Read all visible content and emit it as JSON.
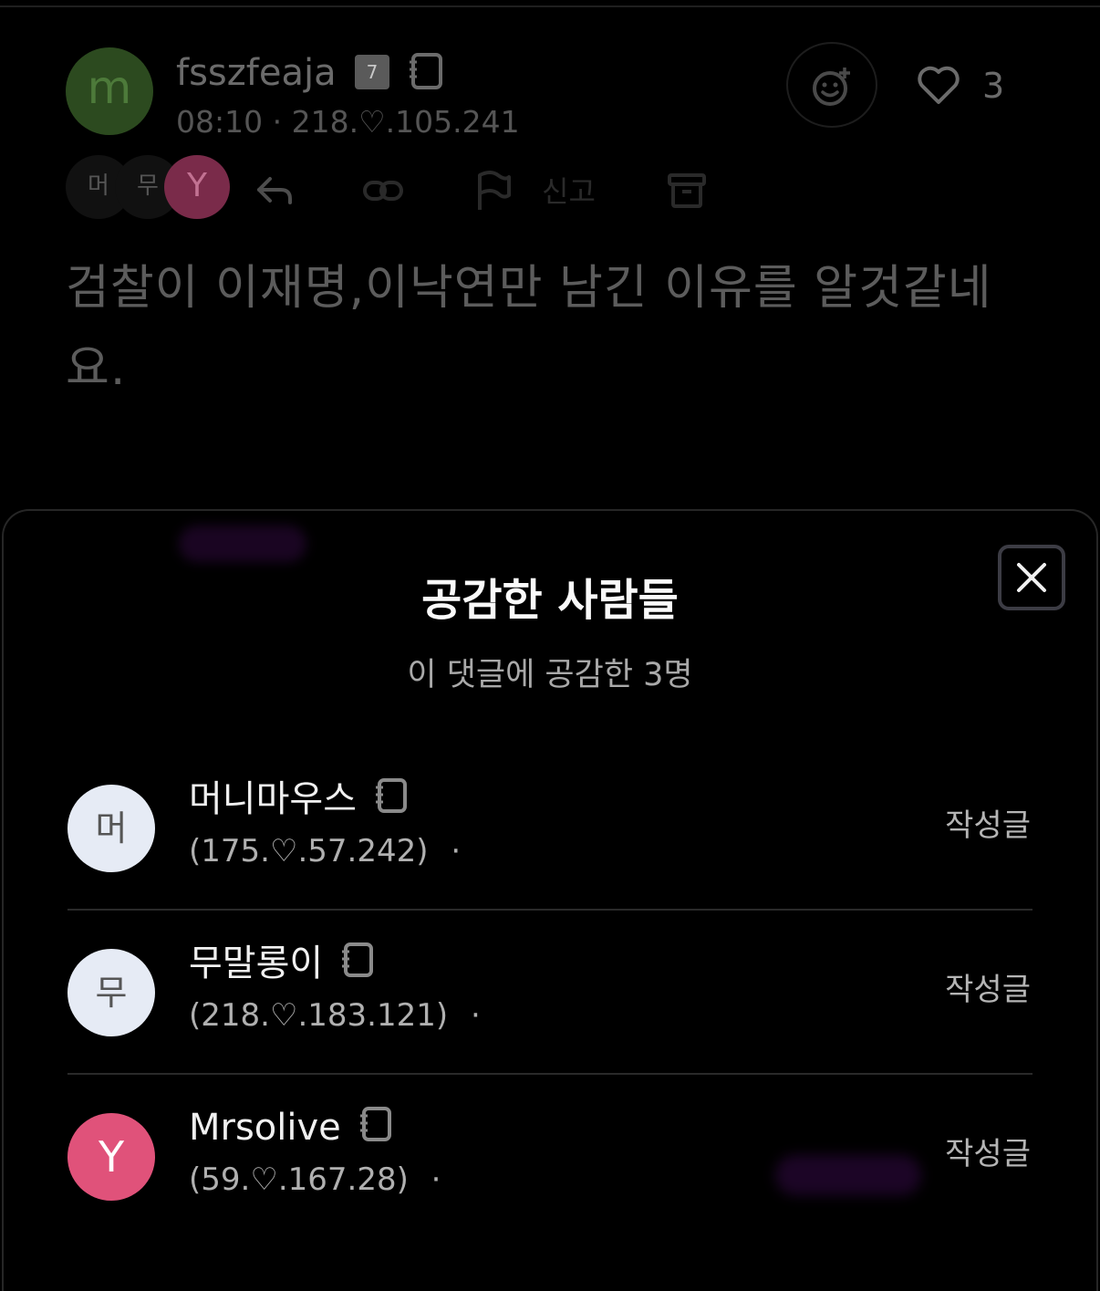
{
  "comment": {
    "avatar_letter": "m",
    "username": "fsszfeaja",
    "level": "7",
    "time": "08:10",
    "ip": "218.♡.105.241",
    "like_count": "3",
    "reactor_letters": [
      "머",
      "무",
      "Y"
    ],
    "report_label": "신고",
    "body": "검찰이 이재명,이낙연만 남긴 이유를 알것같네요.",
    "colors": {
      "avatar_bg": "#2c4a1f",
      "reactor_y": "#7a2b4a"
    }
  },
  "sheet": {
    "title": "공감한 사람들",
    "subtitle": "이 댓글에 공감한 3명",
    "close_icon": "close-icon",
    "users": [
      {
        "avatar": "머",
        "name": "머니마우스",
        "ip": "(175.♡.57.242)",
        "dot": "·",
        "posts_label": "작성글"
      },
      {
        "avatar": "무",
        "name": "무말롱이",
        "ip": "(218.♡.183.121)",
        "dot": "·",
        "posts_label": "작성글"
      },
      {
        "avatar": "Y",
        "name": "Mrsolive",
        "ip": "(59.♡.167.28)",
        "dot": "·",
        "posts_label": "작성글"
      }
    ],
    "colors": {
      "avatar_light": "#e6ebf5",
      "avatar_pink": "#e0527a"
    }
  }
}
